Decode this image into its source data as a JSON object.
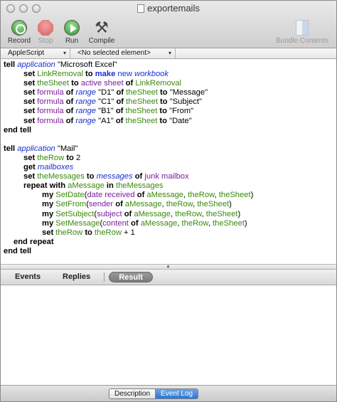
{
  "window": {
    "title": "exportemails"
  },
  "toolbar": {
    "record_label": "Record",
    "stop_label": "Stop",
    "run_label": "Run",
    "compile_label": "Compile",
    "bundle_label": "Bundle Contents"
  },
  "navbar": {
    "language": "AppleScript",
    "element": "<No selected element>"
  },
  "script": {
    "l1": [
      "tell ",
      "application",
      " \"Microsoft Excel\""
    ],
    "l2": [
      "set ",
      "LinkRemoval",
      " to ",
      "make",
      " ",
      "new",
      " ",
      "workbook"
    ],
    "l3": [
      "set ",
      "theSheet",
      " to ",
      "active sheet",
      " ",
      "of",
      " ",
      "LinkRemoval"
    ],
    "l4": [
      "set ",
      "formula",
      " ",
      "of",
      " ",
      "range",
      " \"D1\" ",
      "of",
      " ",
      "theSheet",
      " ",
      "to",
      " \"Message\""
    ],
    "l5": [
      "set ",
      "formula",
      " ",
      "of",
      " ",
      "range",
      " \"C1\" ",
      "of",
      " ",
      "theSheet",
      " ",
      "to",
      " \"Subject\""
    ],
    "l6": [
      "set ",
      "formula",
      " ",
      "of",
      " ",
      "range",
      " \"B1\" ",
      "of",
      " ",
      "theSheet",
      " ",
      "to",
      " \"From\""
    ],
    "l7": [
      "set ",
      "formula",
      " ",
      "of",
      " ",
      "range",
      " \"A1\" ",
      "of",
      " ",
      "theSheet",
      " ",
      "to",
      " \"Date\""
    ],
    "l8": [
      "end tell"
    ],
    "l10": [
      "tell ",
      "application",
      " \"Mail\""
    ],
    "l11": [
      "set ",
      "theRow",
      " to ",
      "2"
    ],
    "l12": [
      "get ",
      "mailboxes"
    ],
    "l13": [
      "set ",
      "theMessages",
      " to ",
      "messages",
      " ",
      "of",
      " ",
      "junk mailbox"
    ],
    "l14": [
      "repeat with ",
      "aMessage",
      " in ",
      "theMessages"
    ],
    "l15": [
      "my ",
      "SetDate",
      "(",
      "date received",
      " ",
      "of",
      " ",
      "aMessage",
      ", ",
      "theRow",
      ", ",
      "theSheet",
      ")"
    ],
    "l16": [
      "my ",
      "SetFrom",
      "(",
      "sender",
      " ",
      "of",
      " ",
      "aMessage",
      ", ",
      "theRow",
      ", ",
      "theSheet",
      ")"
    ],
    "l17": [
      "my ",
      "SetSubject",
      "(",
      "subject",
      " ",
      "of",
      " ",
      "aMessage",
      ", ",
      "theRow",
      ", ",
      "theSheet",
      ")"
    ],
    "l18": [
      "my ",
      "SetMessage",
      "(",
      "content",
      " ",
      "of",
      " ",
      "aMessage",
      ", ",
      "theRow",
      ", ",
      "theSheet",
      ")"
    ],
    "l19": [
      "set ",
      "theRow",
      " to ",
      "theRow",
      " + 1"
    ],
    "l20": [
      "end repeat"
    ],
    "l21": [
      "end tell"
    ]
  },
  "result_tabs": {
    "events": "Events",
    "replies": "Replies",
    "result": "Result"
  },
  "bottom": {
    "description": "Description",
    "event_log": "Event Log"
  }
}
